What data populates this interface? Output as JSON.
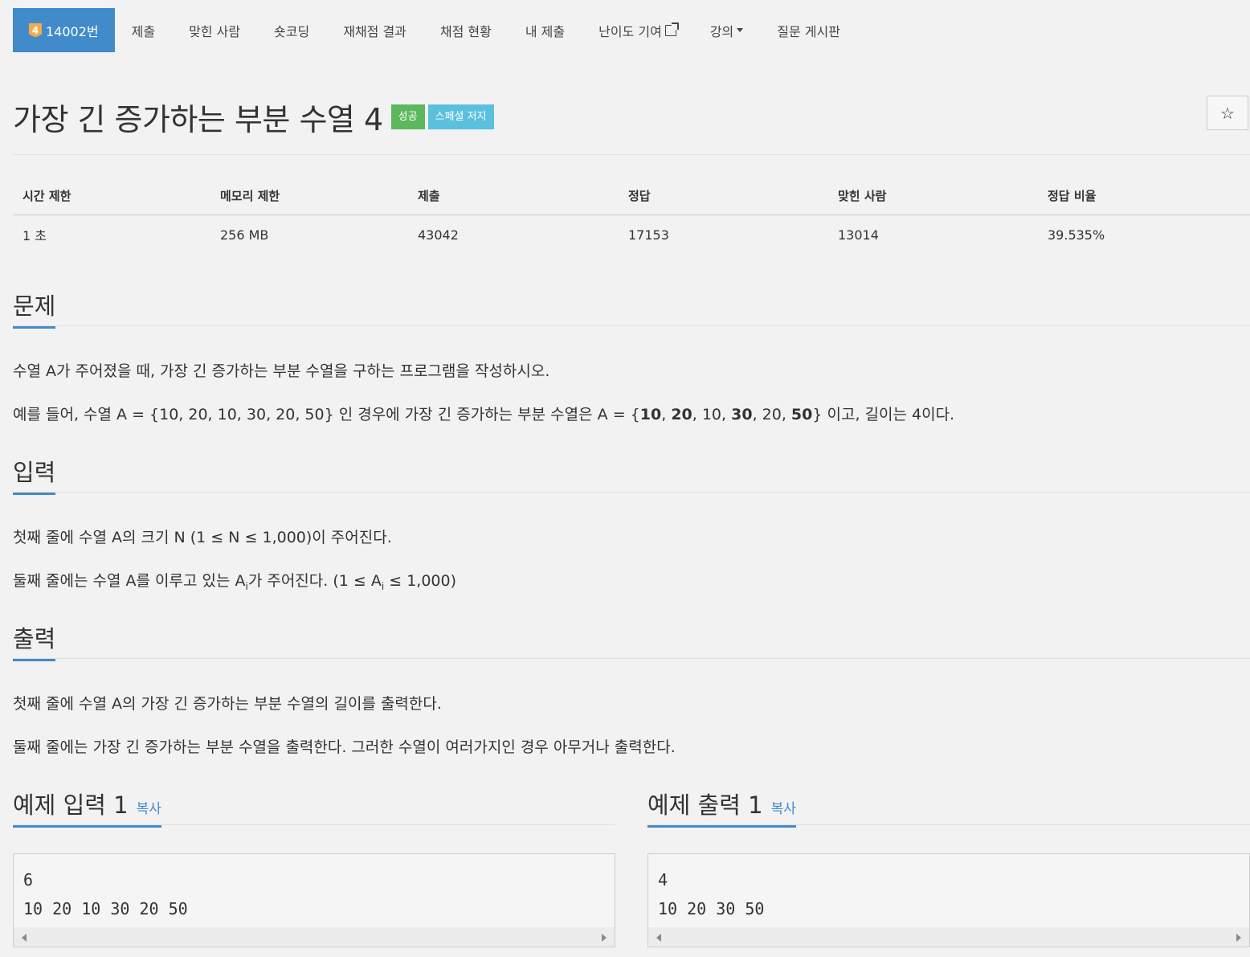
{
  "nav": {
    "problem_number": "14002번",
    "badge": "4",
    "tabs": [
      "제출",
      "맞힌 사람",
      "숏코딩",
      "재채점 결과",
      "채점 현황",
      "내 제출",
      "난이도 기여",
      "강의",
      "질문 게시판"
    ]
  },
  "title": {
    "text": "가장 긴 증가하는 부분 수열 4",
    "label_success": "성공",
    "label_special": "스페셜 저지",
    "star": "☆"
  },
  "info": {
    "headers": [
      "시간 제한",
      "메모리 제한",
      "제출",
      "정답",
      "맞힌 사람",
      "정답 비율"
    ],
    "values": [
      "1 초",
      "256 MB",
      "43042",
      "17153",
      "13014",
      "39.535%"
    ]
  },
  "sections": {
    "problem": {
      "title": "문제",
      "p1": "수열 A가 주어졌을 때, 가장 긴 증가하는 부분 수열을 구하는 프로그램을 작성하시오.",
      "p2_a": "예를 들어, 수열 A = {10, 20, 10, 30, 20, 50} 인 경우에 가장 긴 증가하는 부분 수열은 A = {",
      "p2_b1": "10",
      "p2_s1": ", ",
      "p2_b2": "20",
      "p2_s2": ", 10, ",
      "p2_b3": "30",
      "p2_s3": ", 20, ",
      "p2_b4": "50",
      "p2_c": "} 이고, 길이는 4이다."
    },
    "input": {
      "title": "입력",
      "p1": "첫째 줄에 수열 A의 크기 N (1 ≤ N ≤ 1,000)이 주어진다.",
      "p2_a": "둘째 줄에는 수열 A를 이루고 있는 A",
      "p2_sub1": "i",
      "p2_b": "가 주어진다. (1 ≤ A",
      "p2_sub2": "i",
      "p2_c": " ≤ 1,000)"
    },
    "output": {
      "title": "출력",
      "p1": "첫째 줄에 수열 A의 가장 긴 증가하는 부분 수열의 길이를 출력한다.",
      "p2": "둘째 줄에는 가장 긴 증가하는 부분 수열을 출력한다. 그러한 수열이 여러가지인 경우 아무거나 출력한다."
    },
    "sample_input": {
      "title": "예제 입력 1",
      "copy": "복사",
      "content": "6\n10 20 10 30 20 50"
    },
    "sample_output": {
      "title": "예제 출력 1",
      "copy": "복사",
      "content": "4\n10 20 30 50"
    }
  }
}
